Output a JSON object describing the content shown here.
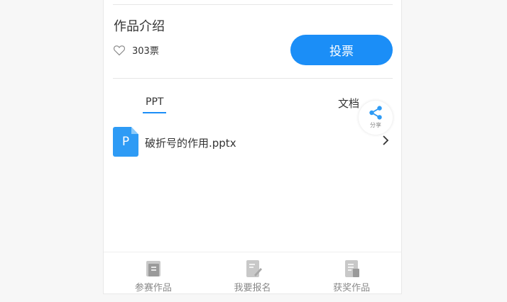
{
  "work": {
    "title": "作品介绍",
    "likes": "303票",
    "vote_label": "投票"
  },
  "tabs": [
    {
      "label": "PPT",
      "active": true
    },
    {
      "label": "文档",
      "active": false
    }
  ],
  "share": {
    "label": "分享",
    "icon": "share-icon"
  },
  "files": [
    {
      "name": "破折号的作用.pptx",
      "type_letter": "P",
      "icon": "ppt-file-icon"
    }
  ],
  "bottom_nav": [
    {
      "label": "参赛作品",
      "icon": "entries-icon"
    },
    {
      "label": "我要报名",
      "icon": "signup-icon"
    },
    {
      "label": "获奖作品",
      "icon": "awards-icon"
    }
  ],
  "colors": {
    "accent": "#1b8ef7",
    "file_icon": "#2e9bf5"
  }
}
